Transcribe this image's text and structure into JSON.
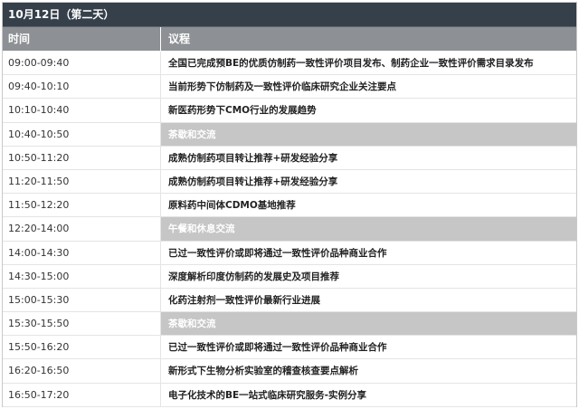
{
  "title": "10月12日（第二天）",
  "header": {
    "time": "时间",
    "topic": "议程"
  },
  "rows": [
    {
      "time": "09:00-09:40",
      "topic": "全国已完成预BE的优质仿制药一致性评价项目发布、制药企业一致性评价需求目录发布",
      "break": false
    },
    {
      "time": "09:40-10:10",
      "topic": "当前形势下仿制药及一致性评价临床研究企业关注要点",
      "break": false
    },
    {
      "time": "10:10-10:40",
      "topic": "新医药形势下CMO行业的发展趋势",
      "break": false
    },
    {
      "time": "10:40-10:50",
      "topic": "茶歇和交流",
      "break": true
    },
    {
      "time": "10:50-11:20",
      "topic": "成熟仿制药项目转让推荐+研发经验分享",
      "break": false
    },
    {
      "time": "11:20-11:50",
      "topic": "成熟仿制药项目转让推荐+研发经验分享",
      "break": false
    },
    {
      "time": "11:50-12:20",
      "topic": "原料药中间体CDMO基地推荐",
      "break": false
    },
    {
      "time": "12:20-14:00",
      "topic": "午餐和休息交流",
      "break": true
    },
    {
      "time": "14:00-14:30",
      "topic": "已过一致性评价或即将通过一致性评价品种商业合作",
      "break": false
    },
    {
      "time": "14:30-15:00",
      "topic": "深度解析印度仿制药的发展史及项目推荐",
      "break": false
    },
    {
      "time": "15:00-15:30",
      "topic": "化药注射剂一致性评价最新行业进展",
      "break": false
    },
    {
      "time": "15:30-15:50",
      "topic": "茶歇和交流",
      "break": true
    },
    {
      "time": "15:50-16:20",
      "topic": "已过一致性评价或即将通过一致性评价品种商业合作",
      "break": false
    },
    {
      "time": "16:20-16:50",
      "topic": "新形式下生物分析实验室的稽查核查要点解析",
      "break": false
    },
    {
      "time": "16:50-17:20",
      "topic": "电子化技术的BE一站式临床研究服务-实例分享",
      "break": false
    }
  ]
}
